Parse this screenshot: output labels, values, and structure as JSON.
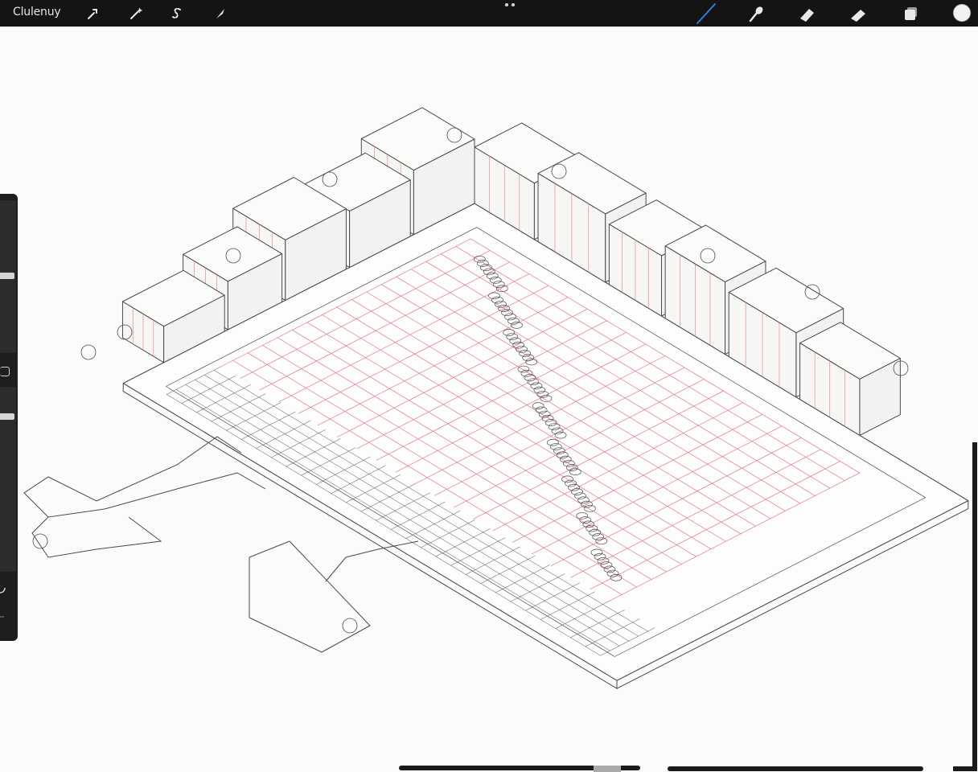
{
  "topbar": {
    "gallery_label": "Clulenuy",
    "left_tools": [
      {
        "name": "wrench-icon"
      },
      {
        "name": "magic-wand-icon"
      },
      {
        "name": "selection-s-icon"
      },
      {
        "name": "transform-arrow-icon"
      }
    ],
    "right_tools": [
      {
        "name": "brush-icon",
        "active": true
      },
      {
        "name": "smudge-icon"
      },
      {
        "name": "eraser-icon"
      },
      {
        "name": "eraser-alt-icon"
      },
      {
        "name": "layers-icon"
      }
    ],
    "color_swatch": "#f2f2f2",
    "accent": "#2f7fe0"
  },
  "canvas": {
    "background": "#fbfbfa",
    "ink_color": "#4a4a4a",
    "grid_color": "#e07a80"
  },
  "sidebar": {
    "brush_size_level": 0.27,
    "opacity_level": 0.45
  }
}
